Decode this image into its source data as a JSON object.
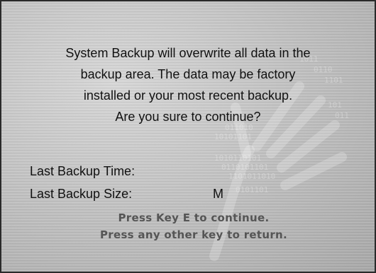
{
  "dialog": {
    "message_lines": [
      "System Backup will overwrite all data in the",
      "backup area. The data may be factory",
      "installed or your most recent backup.",
      "Are you sure to continue?"
    ],
    "last_backup_time_label": "Last Backup Time:",
    "last_backup_time_value": "",
    "last_backup_size_label": "Last Backup Size:",
    "last_backup_size_unit": "M",
    "prompt_continue": "Press Key E to continue.",
    "prompt_return": "Press any other key to return."
  },
  "colors": {
    "text": "#111111",
    "prompt_text": "#555555",
    "background": "#c9c9c9"
  }
}
